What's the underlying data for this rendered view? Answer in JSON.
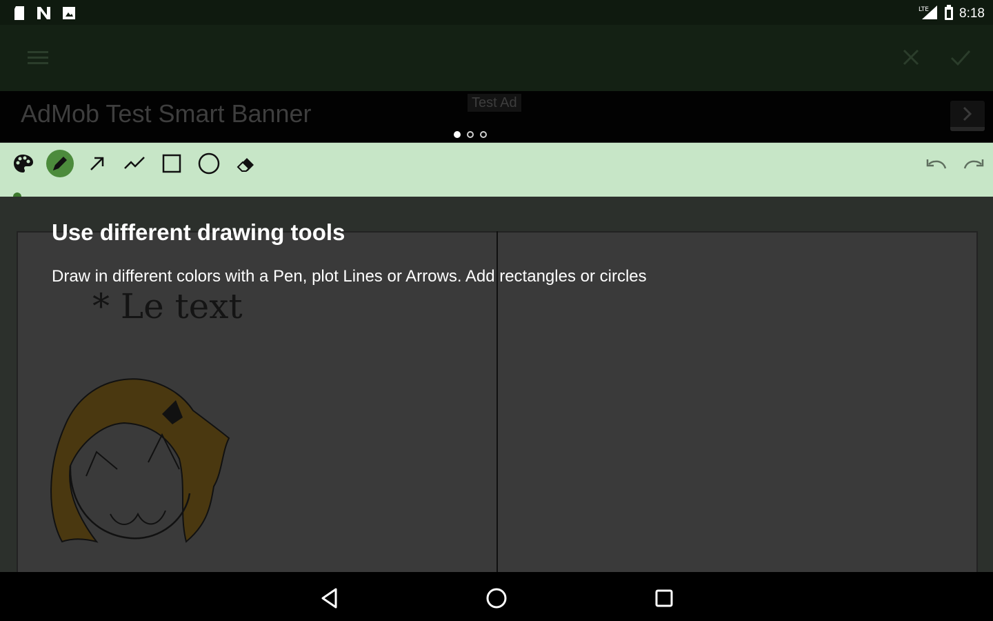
{
  "status_bar": {
    "time": "8:18",
    "left_icons": [
      "sd-card-icon",
      "n-notification-icon",
      "photo-notification-icon"
    ],
    "right_icons": [
      "signal-icon",
      "battery-icon"
    ]
  },
  "app_bar": {
    "icons": [
      "menu-icon",
      "close-icon",
      "check-icon"
    ]
  },
  "ad_banner": {
    "title": "AdMob Test Smart Banner",
    "badge": "Test Ad"
  },
  "toolbar": {
    "tools": [
      "palette-icon",
      "pen-icon",
      "arrow-icon",
      "line-icon",
      "rectangle-icon",
      "circle-icon",
      "eraser-icon"
    ],
    "selected_tool": "pen-icon",
    "actions": [
      "undo-icon",
      "redo-icon"
    ]
  },
  "canvas": {
    "text": "* Le text"
  },
  "tip": {
    "title": "Use different drawing tools",
    "description": "Draw in different colors with a Pen, plot Lines or Arrows. Add rectangles or circles"
  },
  "pager": {
    "total": 3,
    "current": 1
  },
  "nav_bar": {
    "icons": [
      "back-icon",
      "home-icon",
      "recents-icon"
    ]
  },
  "colors": {
    "toolbar_bg": "#c7e6c7",
    "app_bar_bg": "#142114",
    "selected_tool": "#4c8b3c"
  }
}
